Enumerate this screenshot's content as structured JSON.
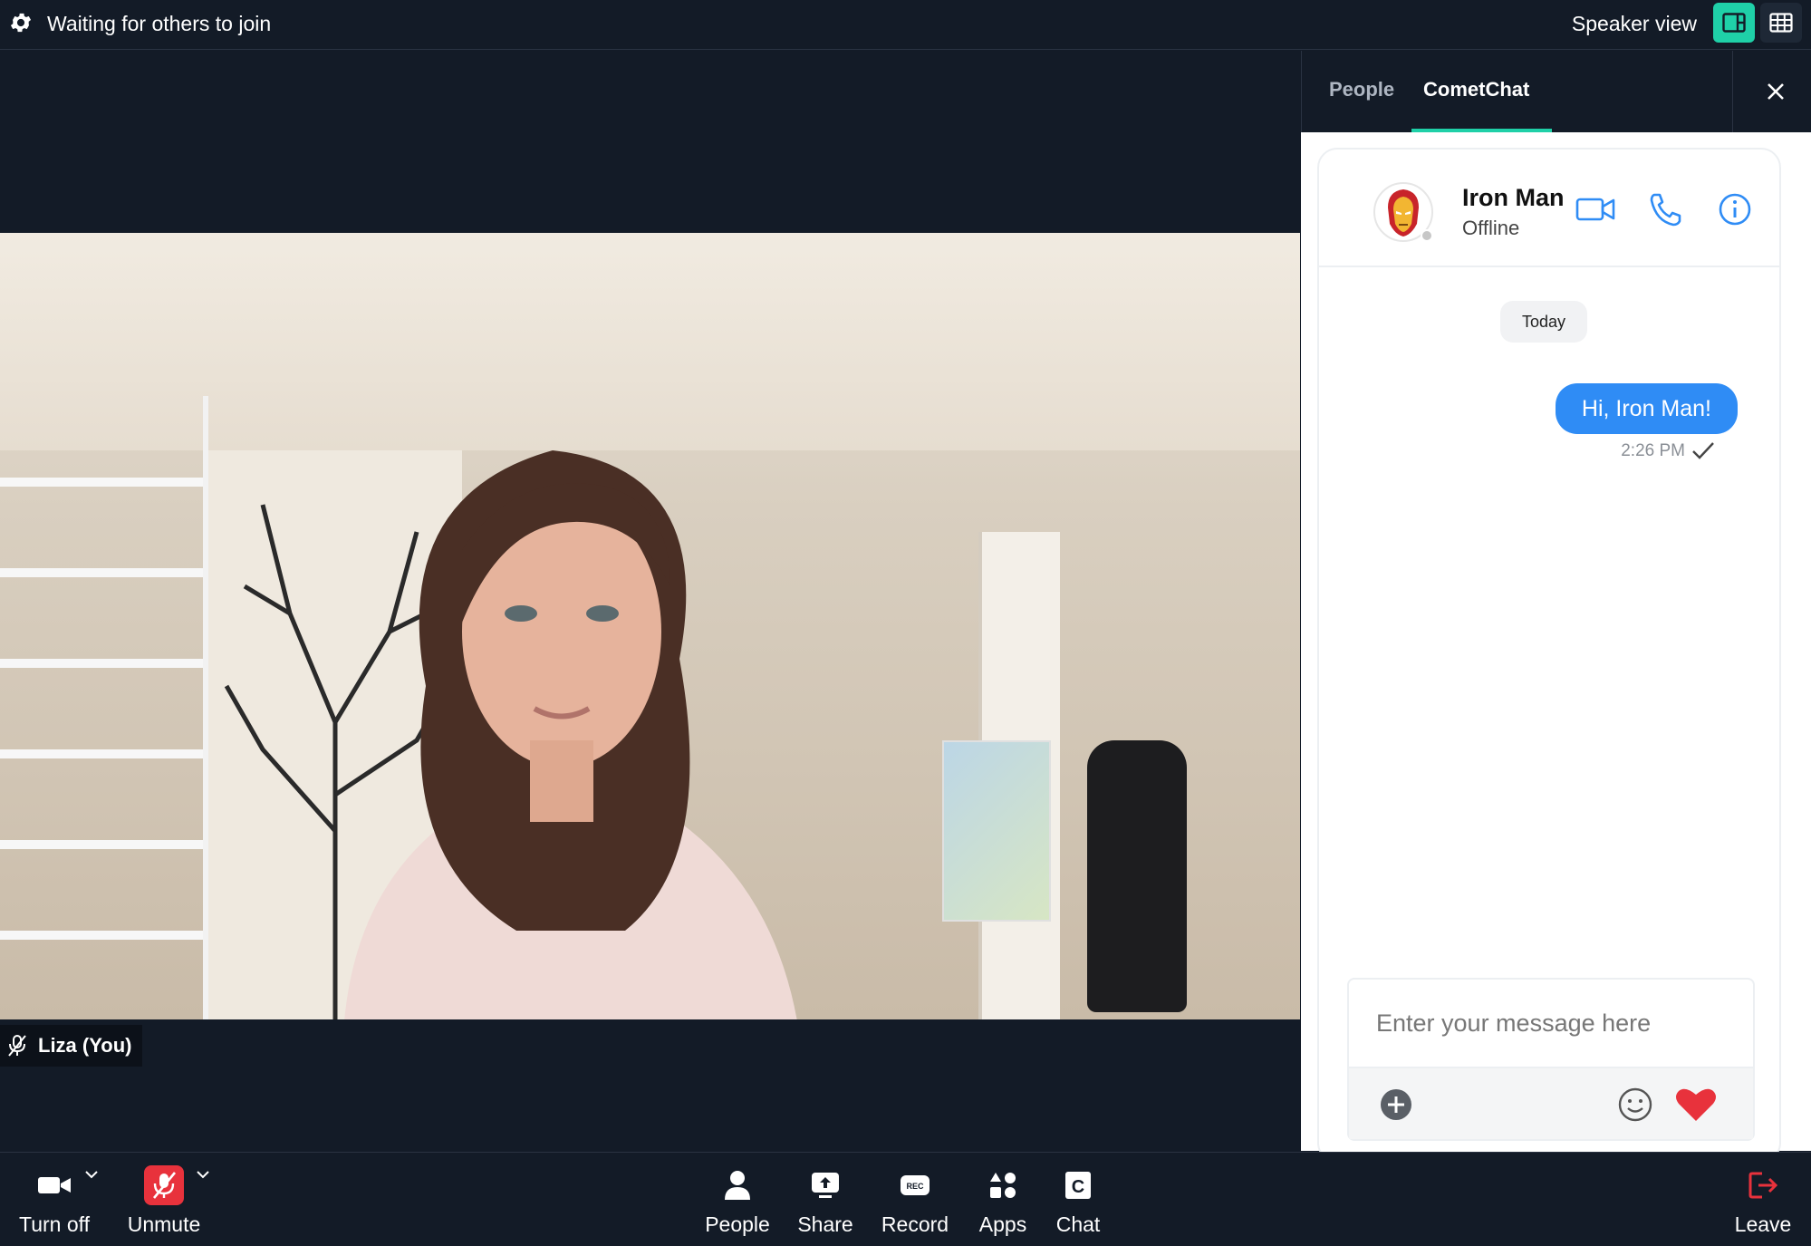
{
  "topbar": {
    "status": "Waiting for others to join",
    "view_label": "Speaker view"
  },
  "video": {
    "participant_name": "Liza (You)"
  },
  "panel": {
    "tabs": [
      "People",
      "CometChat"
    ],
    "active_tab": "CometChat"
  },
  "chat": {
    "contact_name": "Iron Man",
    "contact_status": "Offline",
    "date_separator": "Today",
    "messages": [
      {
        "text": "Hi, Iron Man!",
        "time": "2:26 PM",
        "direction": "outgoing"
      }
    ],
    "composer_placeholder": "Enter your message here"
  },
  "toolbar": {
    "left": [
      {
        "label": "Turn off",
        "icon": "camera-icon"
      },
      {
        "label": "Unmute",
        "icon": "mic-off-icon"
      }
    ],
    "center": [
      {
        "label": "People",
        "icon": "person-icon"
      },
      {
        "label": "Share",
        "icon": "share-icon"
      },
      {
        "label": "Record",
        "icon": "rec-icon"
      },
      {
        "label": "Apps",
        "icon": "apps-icon"
      },
      {
        "label": "Chat",
        "icon": "chat-icon"
      }
    ],
    "right": [
      {
        "label": "Leave",
        "icon": "leave-icon"
      }
    ]
  },
  "colors": {
    "background": "#131b27",
    "accent": "#1fd0a8",
    "bubble": "#2f8cf5",
    "danger": "#e8323c"
  }
}
